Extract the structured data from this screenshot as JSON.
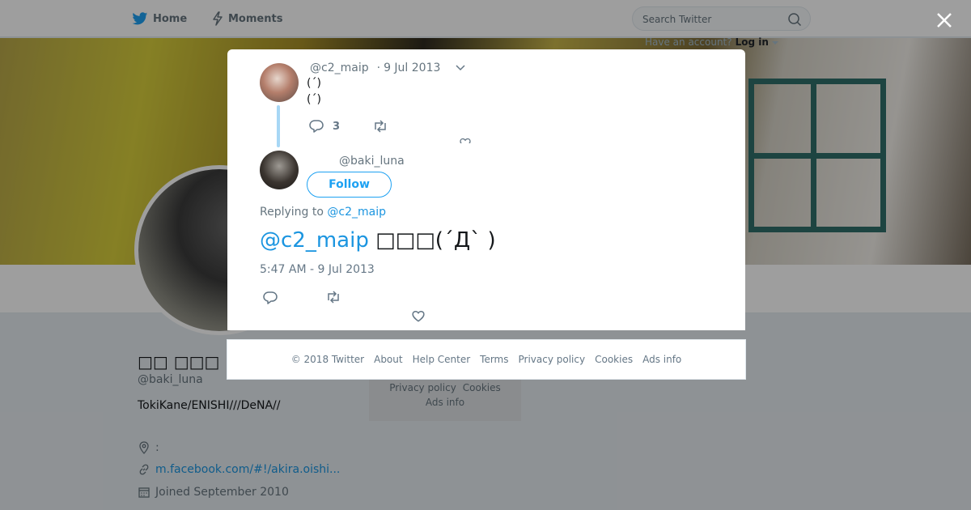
{
  "nav": {
    "home_label": "Home",
    "moments_label": "Moments",
    "search_placeholder": "Search Twitter",
    "have_account": "Have an account?",
    "login_label": "Log in"
  },
  "profile": {
    "name": "□□ □□□ □□□",
    "handle": "@baki_luna",
    "bio": "TokiKane/ENISHI///DeNA//",
    "location": ":",
    "url": "m.facebook.com/#!/akira.oishi...",
    "joined": "Joined September 2010",
    "side_links_row1": [
      "Privacy policy",
      "Cookies"
    ],
    "side_links_row2": "Ads info"
  },
  "parent_tweet": {
    "handle": "@c2_maip",
    "date": "9 Jul 2013",
    "line1": "(´)",
    "line2": "(´)",
    "reply_count": "3"
  },
  "tweet": {
    "handle": "@baki_luna",
    "follow_label": "Follow",
    "replying_prefix": "Replying to",
    "replying_handle": "@c2_maip",
    "mention": "@c2_maip",
    "text": "□□□(´Д` )",
    "timestamp": "5:47 AM - 9 Jul 2013"
  },
  "footer": {
    "copyright": "© 2018 Twitter",
    "links": [
      "About",
      "Help Center",
      "Terms",
      "Privacy policy",
      "Cookies",
      "Ads info"
    ]
  },
  "colors": {
    "accent": "#1da1f2",
    "link": "#1b95e0",
    "thread_line": "#a7d7f5",
    "overlay": "rgba(0,0,0,0.38)"
  },
  "icons": [
    "twitter-bird-icon",
    "lightning-icon",
    "search-icon",
    "close-icon",
    "chevron-down-icon",
    "reply-icon",
    "retweet-icon",
    "heart-icon",
    "location-icon",
    "link-icon",
    "calendar-icon"
  ]
}
